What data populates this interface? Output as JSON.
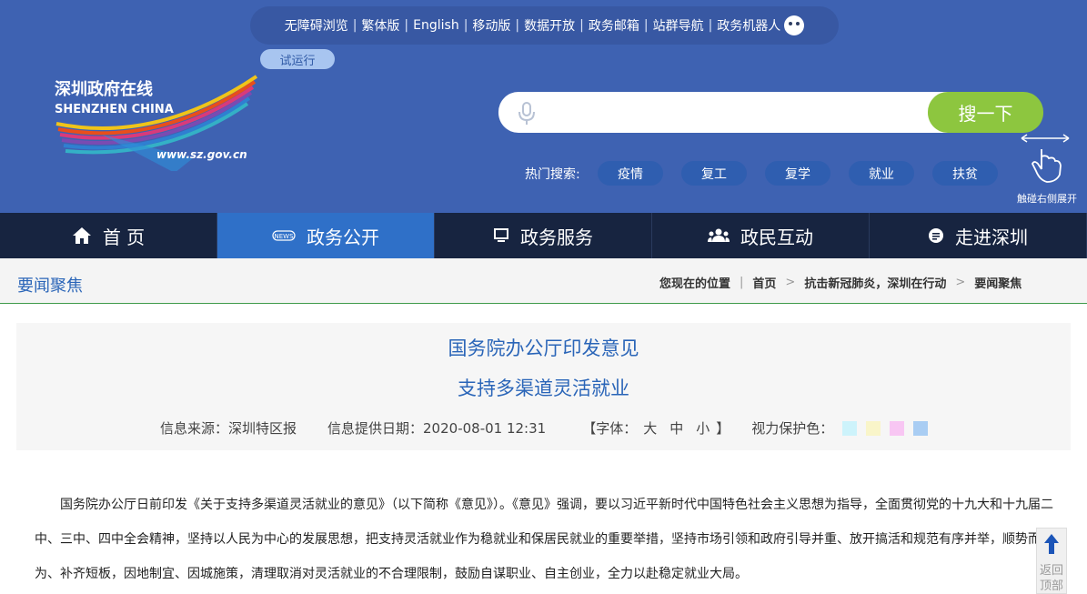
{
  "header": {
    "top_links": [
      "无障碍浏览",
      "繁体版",
      "English",
      "移动版",
      "数据开放",
      "政务邮箱",
      "站群导航",
      "政务机器人"
    ],
    "trial_badge": "试运行",
    "logo": {
      "title_cn": "深圳政府在线",
      "title_en": "SHENZHEN CHINA",
      "url": "www.sz.gov.cn"
    },
    "search": {
      "placeholder": "",
      "button": "搜一下"
    },
    "hot_search": {
      "label": "热门搜索:",
      "tags": [
        "疫情",
        "复工",
        "复学",
        "就业",
        "扶贫"
      ]
    },
    "expand_hint": "触碰右侧展开"
  },
  "nav": {
    "items": [
      {
        "label": "首 页",
        "icon": "home-icon"
      },
      {
        "label": "政务公开",
        "icon": "news-icon"
      },
      {
        "label": "政务服务",
        "icon": "monitor-icon"
      },
      {
        "label": "政民互动",
        "icon": "users-icon"
      },
      {
        "label": "走进深圳",
        "icon": "info-icon"
      }
    ],
    "active_index": 1
  },
  "breadcrumb": {
    "section_title": "要闻聚焦",
    "location_label": "您现在的位置",
    "items": [
      "首页",
      "抗击新冠肺炎，深圳在行动",
      "要闻聚焦"
    ]
  },
  "article": {
    "title_line1": "国务院办公厅印发意见",
    "title_line2": "支持多渠道灵活就业",
    "source": "信息来源：深圳特区报",
    "date": "信息提供日期：2020-08-01 12:31",
    "font_label": "【字体：",
    "font_sizes": [
      "大",
      "中",
      "小"
    ],
    "font_close": "】",
    "eye_color_label": "视力保护色：",
    "eye_colors": [
      "#cdf3fb",
      "#f9f5c9",
      "#f8c6f3",
      "#a9cdf3"
    ],
    "body": [
      "国务院办公厅日前印发《关于支持多渠道灵活就业的意见》（以下简称《意见》）。《意见》强调，要以习近平新时代中国特色社会主义思想为指导，全面贯彻党的十九大和十九届二中、三中、四中全会精神，坚持以人民为中心的发展思想，把支持灵活就业作为稳就业和保居民就业的重要举措，坚持市场引领和政府引导并重、放开搞活和规范有序并举，顺势而为、补齐短板，因地制宜、因城施策，清理取消对灵活就业的不合理限制，鼓励自谋职业、自主创业，全力以赴稳定就业大局。"
    ]
  },
  "back_top": {
    "label": "返回顶部"
  },
  "colors": {
    "header_bg": "#3e62b2",
    "nav_bg": "#172440",
    "nav_active": "#2f70c8",
    "search_button": "#8dc63f",
    "title_blue": "#2a65b8"
  }
}
